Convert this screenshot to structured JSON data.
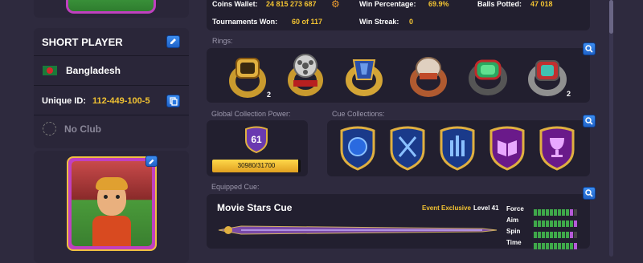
{
  "left": {
    "player_name": "SHORT PLAYER",
    "country": "Bangladesh",
    "unique_id_label": "Unique ID:",
    "unique_id": "112-449-100-5",
    "club": "No Club"
  },
  "stats": {
    "coins_label": "Coins Wallet:",
    "coins_value": "24 815 273 687",
    "win_pct_label": "Win Percentage:",
    "win_pct_value": "69.9%",
    "balls_label": "Balls Potted:",
    "balls_value": "47 018",
    "tournaments_label": "Tournaments Won:",
    "tournaments_value": "60 of 117",
    "streak_label": "Win Streak:",
    "streak_value": "0"
  },
  "rings": {
    "title": "Rings:",
    "items": [
      {
        "name": "gold-ring-icon",
        "count": "2"
      },
      {
        "name": "film-reel-ring-icon",
        "count": ""
      },
      {
        "name": "blue-gem-ring-icon",
        "count": ""
      },
      {
        "name": "silver-dome-ring-icon",
        "count": ""
      },
      {
        "name": "green-gem-ring-icon",
        "count": ""
      },
      {
        "name": "teal-gem-ring-icon",
        "count": "2"
      }
    ]
  },
  "collection": {
    "title": "Global Collection Power:",
    "level": "61",
    "progress_text": "30980/31700",
    "progress_fraction": 0.977
  },
  "cue_collections": {
    "title": "Cue Collections:",
    "items": [
      {
        "name": "blue-globe-shield-icon"
      },
      {
        "name": "crossed-cues-shield-icon"
      },
      {
        "name": "trophy-stack-shield-icon"
      },
      {
        "name": "book-shield-icon"
      },
      {
        "name": "chalice-shield-icon"
      }
    ]
  },
  "equipped": {
    "title": "Equipped Cue:",
    "cue_name": "Movie Stars Cue",
    "tag": "Event Exclusive",
    "level": "Level 41",
    "stats": [
      {
        "label": "Force",
        "filled": 9,
        "purple": 1
      },
      {
        "label": "Aim",
        "filled": 10,
        "purple": 1
      },
      {
        "label": "Spin",
        "filled": 9,
        "purple": 1
      },
      {
        "label": "Time",
        "filled": 10,
        "purple": 1
      }
    ]
  },
  "colors": {
    "accent": "#f1c232",
    "panel": "#221f2f",
    "background": "#2e2a3e",
    "button": "#2a78e0"
  }
}
